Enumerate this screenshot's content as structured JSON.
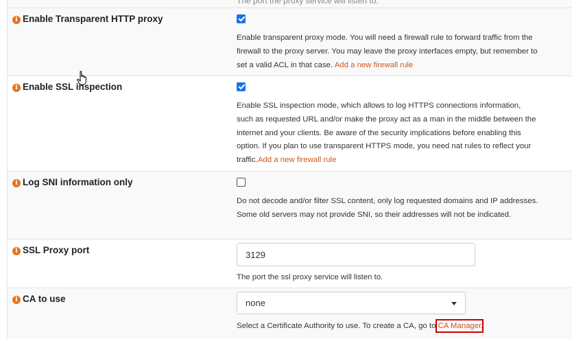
{
  "top_strip": {
    "text": "The port the proxy service will listen to."
  },
  "rows": [
    {
      "label": "Enable Transparent HTTP proxy",
      "checked": true,
      "help_text": "Enable transparent proxy mode. You will need a firewall rule to forward traffic from the firewall to the proxy server. You may leave the proxy interfaces empty, but remember to set a valid ACL in that case. ",
      "help_link": "Add a new firewall rule"
    },
    {
      "label": "Enable SSL inspection",
      "checked": true,
      "help_text": "Enable SSL inspection mode, which allows to log HTTPS connections information, such as requested URL and/or make the proxy act as a man in the middle between the internet and your clients. Be aware of the security implications before enabling this option. If you plan to use transparent HTTPS mode, you need nat rules to reflect your traffic.",
      "help_link": "Add a new firewall rule"
    },
    {
      "label": "Log SNI information only",
      "checked": false,
      "help_text": "Do not decode and/or filter SSL content, only log requested domains and IP addresses. Some old servers may not provide SNI, so their addresses will not be indicated."
    },
    {
      "label": "SSL Proxy port",
      "value": "3129",
      "help_text": "The port the ssl proxy service will listen to."
    },
    {
      "label": "CA to use",
      "selected": "none",
      "help_text": "Select a Certificate Authority to use. To create a CA, go to ",
      "help_link": "CA Manager",
      "help_suffix": "."
    }
  ],
  "colors": {
    "accent_orange": "#e8741b",
    "link": "#d0571d",
    "checkbox_blue": "#1a73e8",
    "highlight_red": "#cc0000"
  }
}
